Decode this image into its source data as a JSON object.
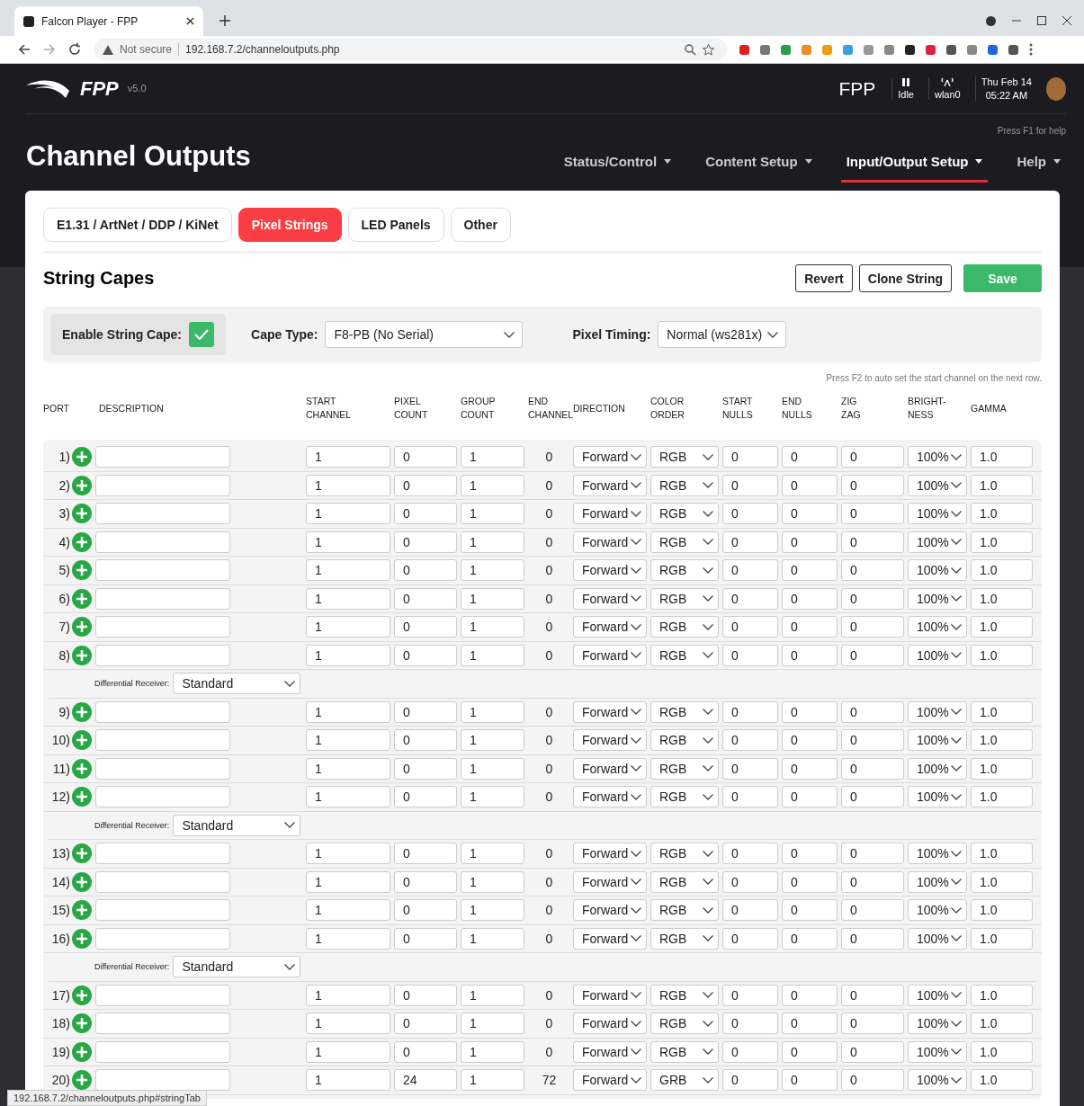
{
  "browser": {
    "tab_title": "Falcon Player - FPP",
    "security": "Not secure",
    "url": "192.168.7.2/channeloutputs.php",
    "status_url": "192.168.7.2/channeloutputs.php#stringTab"
  },
  "header": {
    "brand": "FPP",
    "version": "v5.0",
    "host": "FPP",
    "status": "Idle",
    "interface": "wlan0",
    "date": "Thu Feb 14",
    "time": "05:22 AM",
    "help_hint": "Press F1 for help",
    "title": "Channel Outputs",
    "nav": [
      {
        "label": "Status/Control",
        "selected": false
      },
      {
        "label": "Content Setup",
        "selected": false
      },
      {
        "label": "Input/Output Setup",
        "selected": true
      },
      {
        "label": "Help",
        "selected": false
      }
    ]
  },
  "tabs": [
    {
      "label": "E1.31 / ArtNet / DDP / KiNet",
      "selected": false
    },
    {
      "label": "Pixel Strings",
      "selected": true
    },
    {
      "label": "LED Panels",
      "selected": false
    },
    {
      "label": "Other",
      "selected": false
    }
  ],
  "section": {
    "title": "String Capes",
    "buttons": [
      "Revert",
      "Clone String"
    ],
    "save": "Save"
  },
  "enable_string_cape": {
    "label": "Enable String Cape:",
    "checked": true
  },
  "cape_type": {
    "label": "Cape Type:",
    "value": "F8-PB (No Serial)"
  },
  "pixel_timing": {
    "label": "Pixel Timing:",
    "value": "Normal (ws281x)"
  },
  "hint": "Press F2 to auto set the start channel on the next row.",
  "columns": [
    [
      "PORT"
    ],
    [
      "DESCRIPTION"
    ],
    [
      "START",
      "CHANNEL"
    ],
    [
      "PIXEL",
      "COUNT"
    ],
    [
      "GROUP",
      "COUNT"
    ],
    [
      "END",
      "CHANNEL"
    ],
    [
      "DIRECTION"
    ],
    [
      "COLOR",
      "ORDER"
    ],
    [
      "START",
      "NULLS"
    ],
    [
      "END",
      "NULLS"
    ],
    [
      "ZIG",
      "ZAG"
    ],
    [
      "BRIGHT-",
      "NESS"
    ],
    [
      "GAMMA"
    ]
  ],
  "rows": [
    {
      "kind": "port",
      "port": "1)",
      "start": "1",
      "pixels": "0",
      "group": "1",
      "end": "0",
      "direction": "Forward",
      "order": "RGB",
      "start_nulls": "0",
      "end_nulls": "0",
      "zigzag": "0",
      "brightness": "100%",
      "gamma": "1.0"
    },
    {
      "kind": "port",
      "port": "2)",
      "start": "1",
      "pixels": "0",
      "group": "1",
      "end": "0",
      "direction": "Forward",
      "order": "RGB",
      "start_nulls": "0",
      "end_nulls": "0",
      "zigzag": "0",
      "brightness": "100%",
      "gamma": "1.0"
    },
    {
      "kind": "port",
      "port": "3)",
      "start": "1",
      "pixels": "0",
      "group": "1",
      "end": "0",
      "direction": "Forward",
      "order": "RGB",
      "start_nulls": "0",
      "end_nulls": "0",
      "zigzag": "0",
      "brightness": "100%",
      "gamma": "1.0"
    },
    {
      "kind": "port",
      "port": "4)",
      "start": "1",
      "pixels": "0",
      "group": "1",
      "end": "0",
      "direction": "Forward",
      "order": "RGB",
      "start_nulls": "0",
      "end_nulls": "0",
      "zigzag": "0",
      "brightness": "100%",
      "gamma": "1.0"
    },
    {
      "kind": "port",
      "port": "5)",
      "start": "1",
      "pixels": "0",
      "group": "1",
      "end": "0",
      "direction": "Forward",
      "order": "RGB",
      "start_nulls": "0",
      "end_nulls": "0",
      "zigzag": "0",
      "brightness": "100%",
      "gamma": "1.0"
    },
    {
      "kind": "port",
      "port": "6)",
      "start": "1",
      "pixels": "0",
      "group": "1",
      "end": "0",
      "direction": "Forward",
      "order": "RGB",
      "start_nulls": "0",
      "end_nulls": "0",
      "zigzag": "0",
      "brightness": "100%",
      "gamma": "1.0"
    },
    {
      "kind": "port",
      "port": "7)",
      "start": "1",
      "pixels": "0",
      "group": "1",
      "end": "0",
      "direction": "Forward",
      "order": "RGB",
      "start_nulls": "0",
      "end_nulls": "0",
      "zigzag": "0",
      "brightness": "100%",
      "gamma": "1.0"
    },
    {
      "kind": "port",
      "port": "8)",
      "start": "1",
      "pixels": "0",
      "group": "1",
      "end": "0",
      "direction": "Forward",
      "order": "RGB",
      "start_nulls": "0",
      "end_nulls": "0",
      "zigzag": "0",
      "brightness": "100%",
      "gamma": "1.0"
    },
    {
      "kind": "receiver",
      "label": "Differential Receiver:",
      "value": "Standard"
    },
    {
      "kind": "port",
      "port": "9)",
      "start": "1",
      "pixels": "0",
      "group": "1",
      "end": "0",
      "direction": "Forward",
      "order": "RGB",
      "start_nulls": "0",
      "end_nulls": "0",
      "zigzag": "0",
      "brightness": "100%",
      "gamma": "1.0"
    },
    {
      "kind": "port",
      "port": "10)",
      "start": "1",
      "pixels": "0",
      "group": "1",
      "end": "0",
      "direction": "Forward",
      "order": "RGB",
      "start_nulls": "0",
      "end_nulls": "0",
      "zigzag": "0",
      "brightness": "100%",
      "gamma": "1.0"
    },
    {
      "kind": "port",
      "port": "11)",
      "start": "1",
      "pixels": "0",
      "group": "1",
      "end": "0",
      "direction": "Forward",
      "order": "RGB",
      "start_nulls": "0",
      "end_nulls": "0",
      "zigzag": "0",
      "brightness": "100%",
      "gamma": "1.0"
    },
    {
      "kind": "port",
      "port": "12)",
      "start": "1",
      "pixels": "0",
      "group": "1",
      "end": "0",
      "direction": "Forward",
      "order": "RGB",
      "start_nulls": "0",
      "end_nulls": "0",
      "zigzag": "0",
      "brightness": "100%",
      "gamma": "1.0"
    },
    {
      "kind": "receiver",
      "label": "Differential Receiver:",
      "value": "Standard"
    },
    {
      "kind": "port",
      "port": "13)",
      "start": "1",
      "pixels": "0",
      "group": "1",
      "end": "0",
      "direction": "Forward",
      "order": "RGB",
      "start_nulls": "0",
      "end_nulls": "0",
      "zigzag": "0",
      "brightness": "100%",
      "gamma": "1.0"
    },
    {
      "kind": "port",
      "port": "14)",
      "start": "1",
      "pixels": "0",
      "group": "1",
      "end": "0",
      "direction": "Forward",
      "order": "RGB",
      "start_nulls": "0",
      "end_nulls": "0",
      "zigzag": "0",
      "brightness": "100%",
      "gamma": "1.0"
    },
    {
      "kind": "port",
      "port": "15)",
      "start": "1",
      "pixels": "0",
      "group": "1",
      "end": "0",
      "direction": "Forward",
      "order": "RGB",
      "start_nulls": "0",
      "end_nulls": "0",
      "zigzag": "0",
      "brightness": "100%",
      "gamma": "1.0"
    },
    {
      "kind": "port",
      "port": "16)",
      "start": "1",
      "pixels": "0",
      "group": "1",
      "end": "0",
      "direction": "Forward",
      "order": "RGB",
      "start_nulls": "0",
      "end_nulls": "0",
      "zigzag": "0",
      "brightness": "100%",
      "gamma": "1.0"
    },
    {
      "kind": "receiver",
      "label": "Differential Receiver:",
      "value": "Standard"
    },
    {
      "kind": "port",
      "port": "17)",
      "start": "1",
      "pixels": "0",
      "group": "1",
      "end": "0",
      "direction": "Forward",
      "order": "RGB",
      "start_nulls": "0",
      "end_nulls": "0",
      "zigzag": "0",
      "brightness": "100%",
      "gamma": "1.0"
    },
    {
      "kind": "port",
      "port": "18)",
      "start": "1",
      "pixels": "0",
      "group": "1",
      "end": "0",
      "direction": "Forward",
      "order": "RGB",
      "start_nulls": "0",
      "end_nulls": "0",
      "zigzag": "0",
      "brightness": "100%",
      "gamma": "1.0"
    },
    {
      "kind": "port",
      "port": "19)",
      "start": "1",
      "pixels": "0",
      "group": "1",
      "end": "0",
      "direction": "Forward",
      "order": "RGB",
      "start_nulls": "0",
      "end_nulls": "0",
      "zigzag": "0",
      "brightness": "100%",
      "gamma": "1.0"
    },
    {
      "kind": "port",
      "port": "20)",
      "start": "1",
      "pixels": "24",
      "group": "1",
      "end": "72",
      "direction": "Forward",
      "order": "GRB",
      "start_nulls": "0",
      "end_nulls": "0",
      "zigzag": "0",
      "brightness": "100%",
      "gamma": "1.0"
    }
  ]
}
